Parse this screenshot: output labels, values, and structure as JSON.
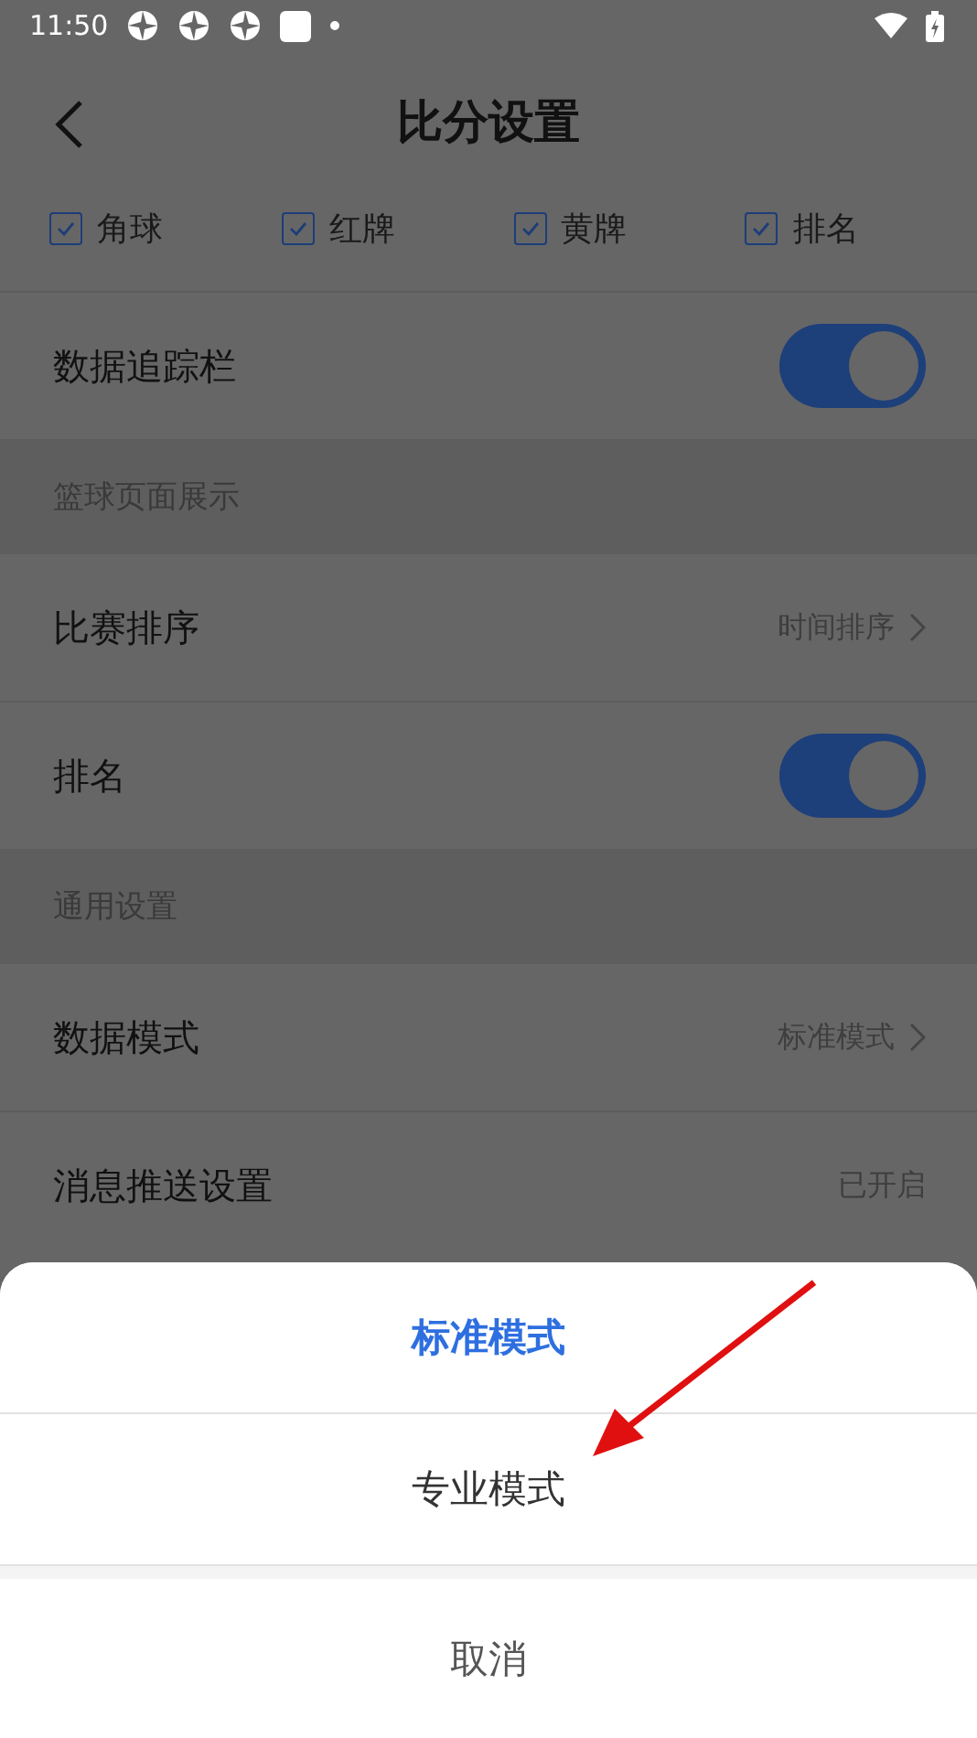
{
  "status_bar": {
    "time": "11:50"
  },
  "header": {
    "title": "比分设置"
  },
  "filters": [
    {
      "label": "角球",
      "checked": true
    },
    {
      "label": "红牌",
      "checked": true
    },
    {
      "label": "黄牌",
      "checked": true
    },
    {
      "label": "排名",
      "checked": true
    }
  ],
  "sections": [
    {
      "rows": [
        {
          "kind": "toggle",
          "label": "数据追踪栏",
          "on": true
        }
      ]
    },
    {
      "title": "篮球页面展示",
      "rows": [
        {
          "kind": "link",
          "label": "比赛排序",
          "value": "时间排序"
        },
        {
          "kind": "toggle",
          "label": "排名",
          "on": true
        }
      ]
    },
    {
      "title": "通用设置",
      "rows": [
        {
          "kind": "link",
          "label": "数据模式",
          "value": "标准模式"
        },
        {
          "kind": "value",
          "label": "消息推送设置",
          "value": "已开启"
        }
      ]
    }
  ],
  "action_sheet": {
    "options": [
      {
        "label": "标准模式",
        "selected": true
      },
      {
        "label": "专业模式",
        "selected": false
      }
    ],
    "cancel": "取消"
  }
}
